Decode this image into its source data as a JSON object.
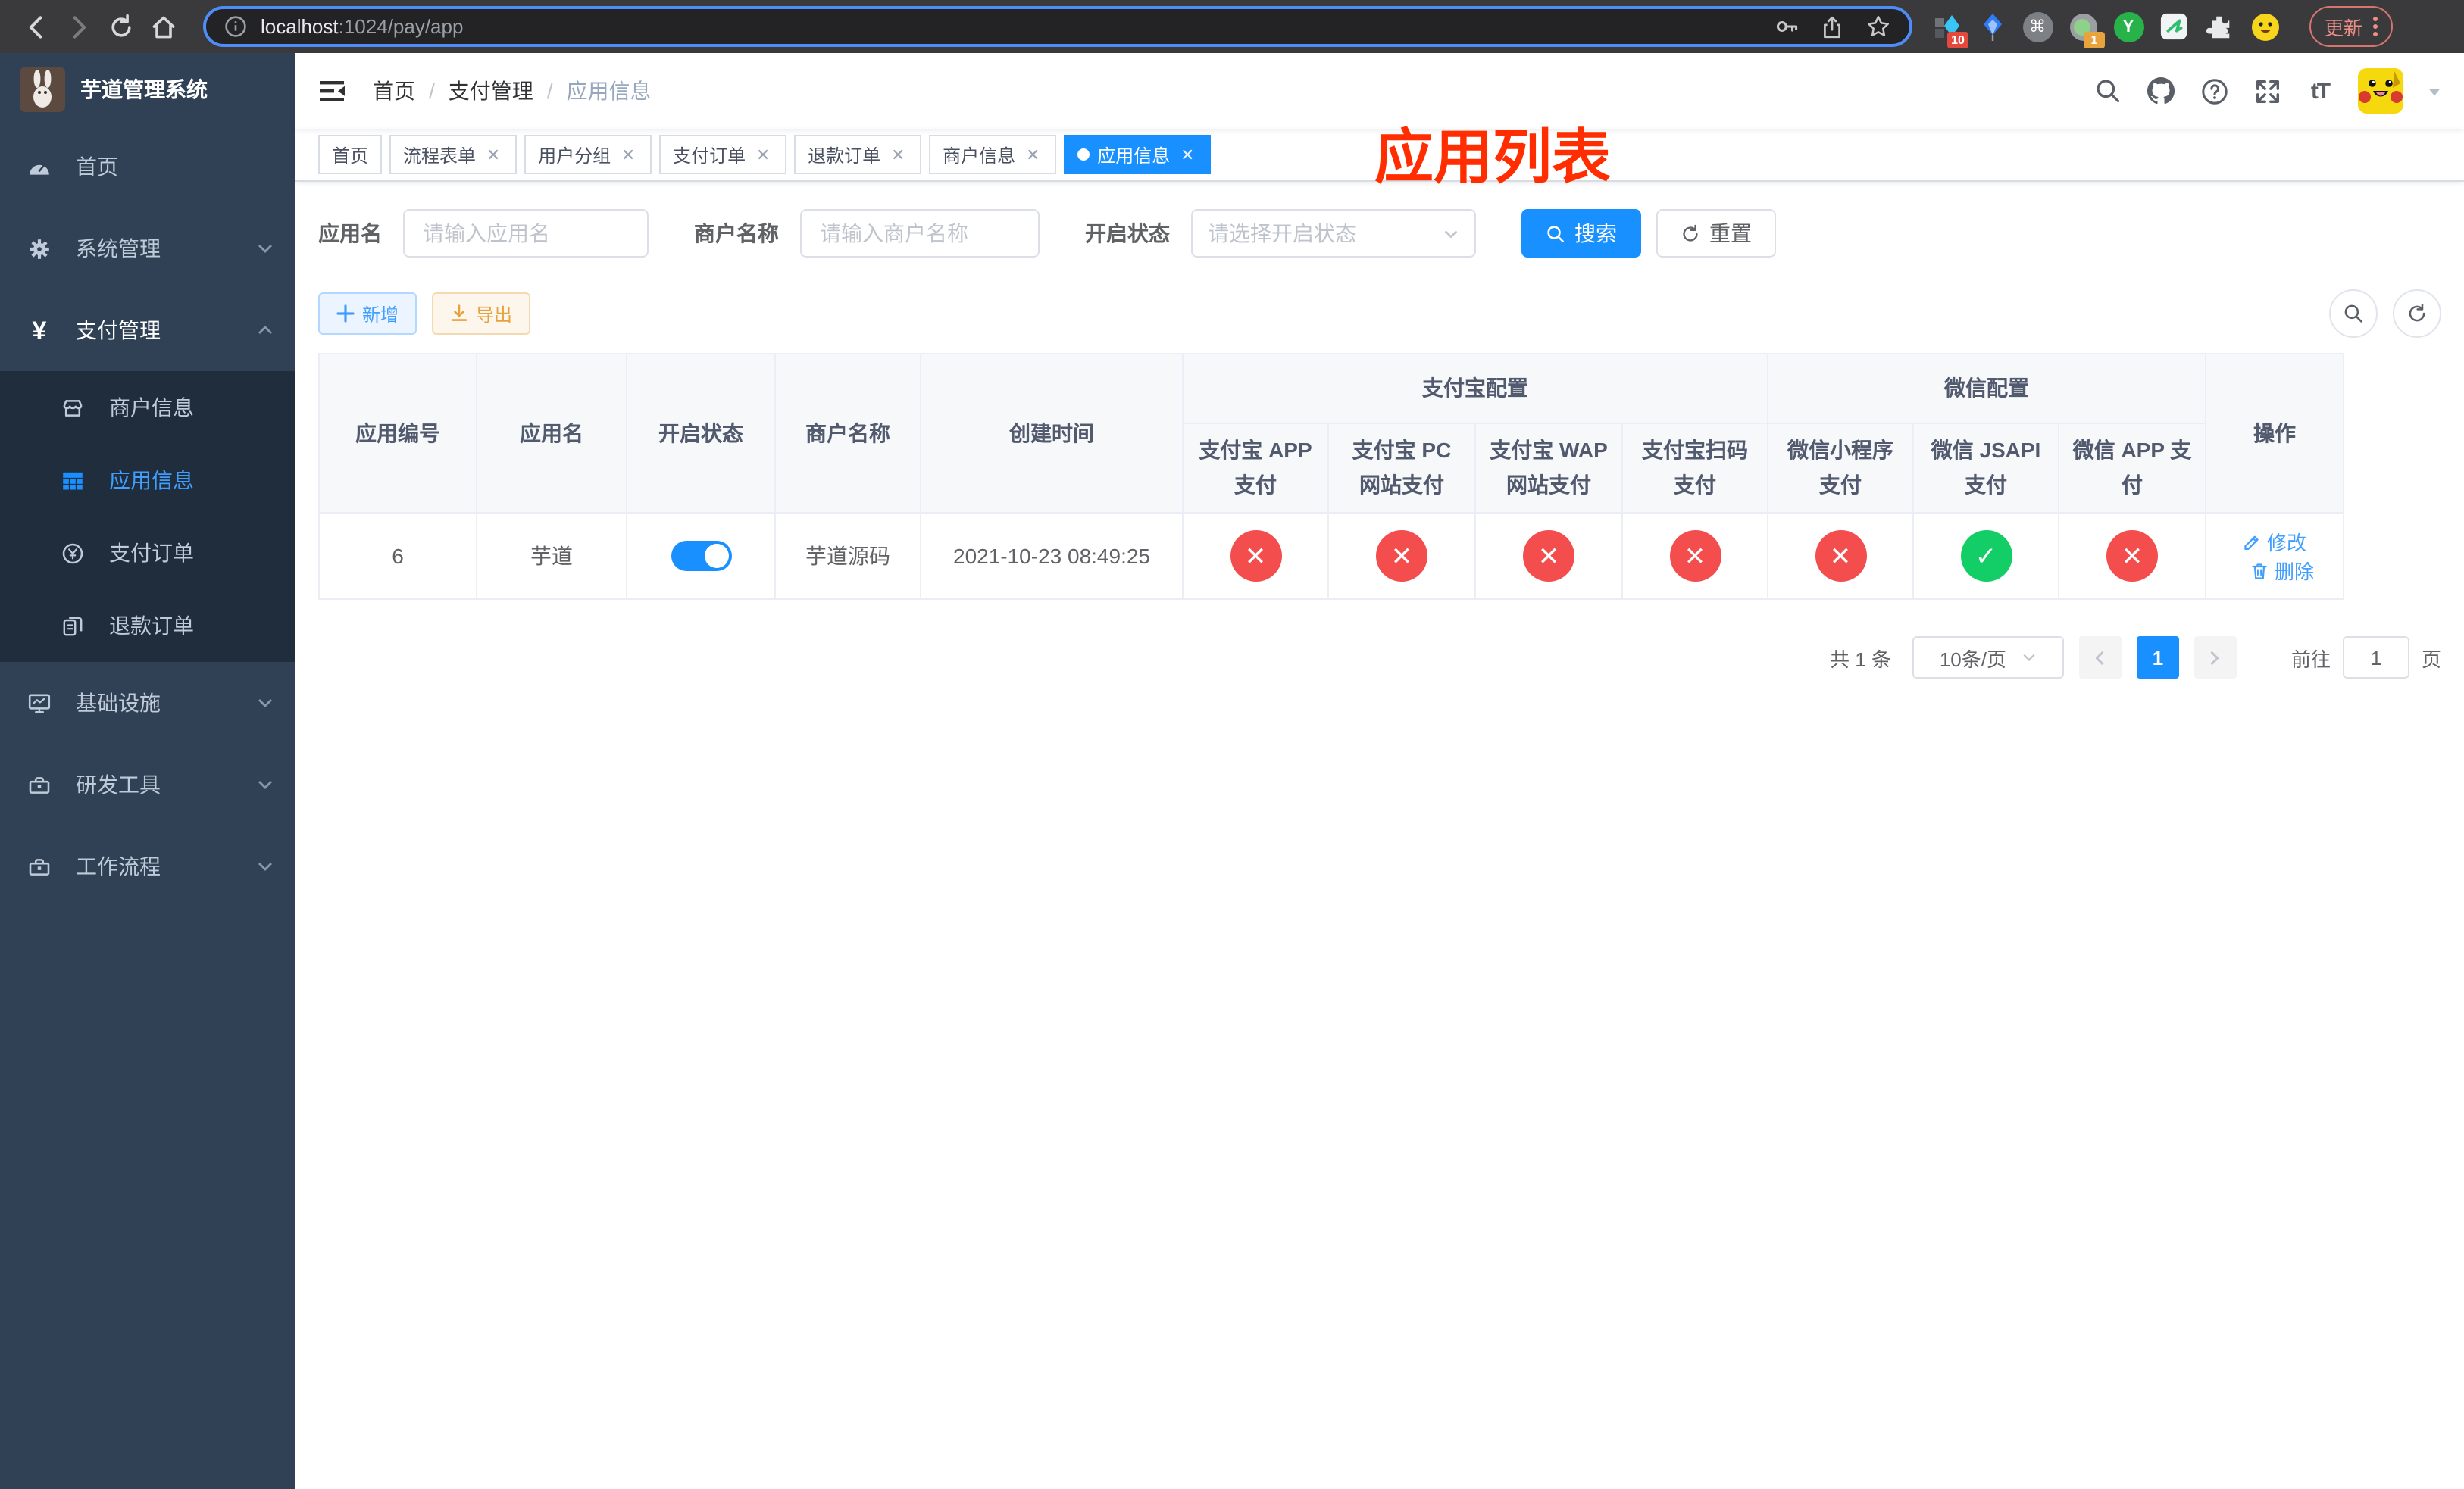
{
  "browser": {
    "url_host": "localhost",
    "url_path": ":1024/pay/app",
    "update_label": "更新",
    "ext_badge_1": "10",
    "ext_badge_2": "1",
    "ext_y_label": "Y"
  },
  "annotation": {
    "text": "应用列表"
  },
  "sidebar": {
    "app_title": "芋道管理系统",
    "items": [
      {
        "label": "首页"
      },
      {
        "label": "系统管理"
      },
      {
        "label": "支付管理"
      },
      {
        "label": "商户信息"
      },
      {
        "label": "应用信息"
      },
      {
        "label": "支付订单"
      },
      {
        "label": "退款订单"
      },
      {
        "label": "基础设施"
      },
      {
        "label": "研发工具"
      },
      {
        "label": "工作流程"
      }
    ],
    "yen_glyph": "¥"
  },
  "breadcrumb": {
    "items": [
      "首页",
      "支付管理",
      "应用信息"
    ],
    "separator": "/"
  },
  "tabs": [
    {
      "label": "首页"
    },
    {
      "label": "流程表单"
    },
    {
      "label": "用户分组"
    },
    {
      "label": "支付订单"
    },
    {
      "label": "退款订单"
    },
    {
      "label": "商户信息"
    },
    {
      "label": "应用信息"
    }
  ],
  "tab_close_glyph": "✕",
  "filters": {
    "app_name_label": "应用名",
    "app_name_placeholder": "请输入应用名",
    "merchant_label": "商户名称",
    "merchant_placeholder": "请输入商户名称",
    "status_label": "开启状态",
    "status_placeholder": "请选择开启状态",
    "search_label": "搜索",
    "reset_label": "重置"
  },
  "toolbar": {
    "add_label": "新增",
    "export_label": "导出"
  },
  "table": {
    "groups": {
      "alipay": "支付宝配置",
      "wechat": "微信配置"
    },
    "columns": {
      "id": "应用编号",
      "name": "应用名",
      "status": "开启状态",
      "merchant": "商户名称",
      "created": "创建时间",
      "alipay_app": "支付宝 APP 支付",
      "alipay_pc": "支付宝 PC 网站支付",
      "alipay_wap": "支付宝 WAP 网站支付",
      "alipay_qr": "支付宝扫码支付",
      "wx_lite": "微信小程序支付",
      "wx_jsapi": "微信 JSAPI 支付",
      "wx_app": "微信 APP 支付",
      "actions": "操作"
    },
    "row": {
      "id": "6",
      "name": "芋道",
      "enabled": true,
      "merchant": "芋道源码",
      "created": "2021-10-23 08:49:25",
      "statuses": [
        false,
        false,
        false,
        false,
        false,
        true,
        false
      ]
    },
    "edit_label": "修改",
    "delete_label": "删除"
  },
  "pagination": {
    "total": "共 1 条",
    "size": "10条/页",
    "page": "1",
    "goto_label": "前往",
    "goto_value": "1",
    "page_unit": "页"
  },
  "colors": {
    "primary": "#1890ff",
    "link": "#409eff",
    "success": "#13ce66",
    "danger": "#f34d4d",
    "warning": "#e6a23c",
    "sidebar_bg": "#304156",
    "annotation": "#ff2d00"
  }
}
